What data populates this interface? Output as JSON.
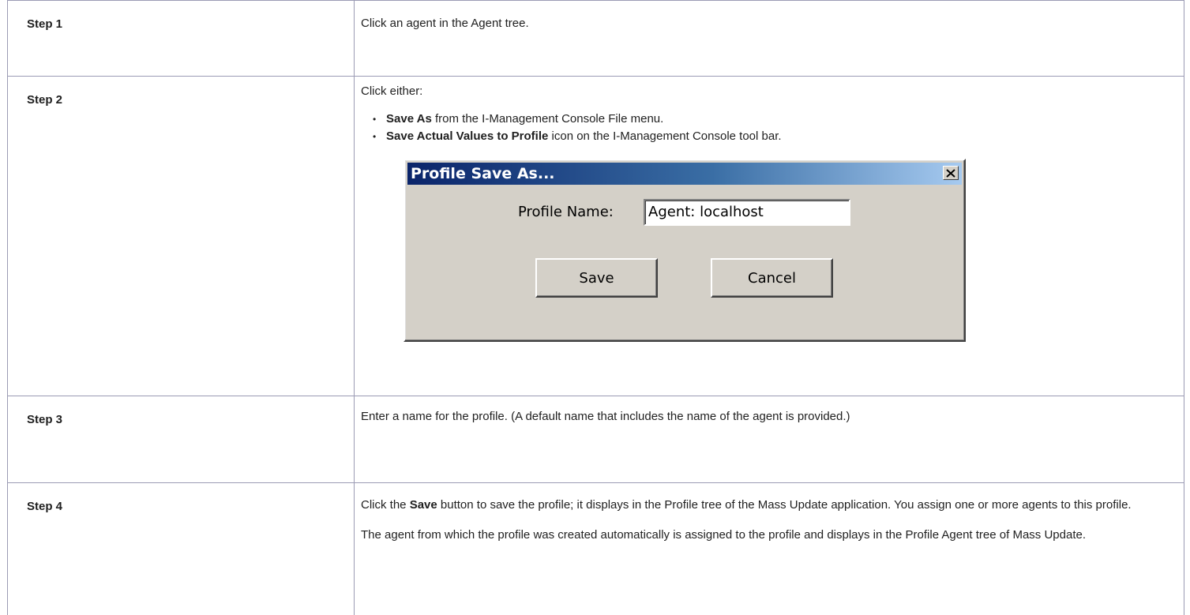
{
  "steps": [
    {
      "label": "Step 1",
      "text": "Click an agent in the Agent tree."
    },
    {
      "label": "Step 2",
      "intro": "Click either:",
      "options": [
        {
          "bold": "Save As",
          "rest": " from the I-Management Console File menu."
        },
        {
          "bold": "Save Actual Values to Profile",
          "rest": " icon on the I-Management Console tool bar."
        }
      ]
    },
    {
      "label": "Step 3",
      "text": "Enter a name for the profile. (A default name that includes the name of the agent is provided.)"
    },
    {
      "label": "Step 4",
      "p1_pre": "Click the ",
      "p1_bold": "Save",
      "p1_post": " button to save the profile; it displays in the Profile tree of the Mass Update application. You assign one or more agents to this profile.",
      "p2": "The agent from which the profile was created automatically is assigned to the profile and displays in the Profile Agent tree of Mass Update."
    }
  ],
  "dialog": {
    "title": "Profile Save As...",
    "field_label": "Profile Name:",
    "field_value": "Agent: localhost",
    "save_label": "Save",
    "cancel_label": "Cancel",
    "close_icon": "close-icon"
  },
  "colors": {
    "border": "#9b9bb4",
    "dialog_face": "#d4d0c8",
    "titlebar_start": "#0a246a",
    "titlebar_end": "#a6caf0"
  }
}
